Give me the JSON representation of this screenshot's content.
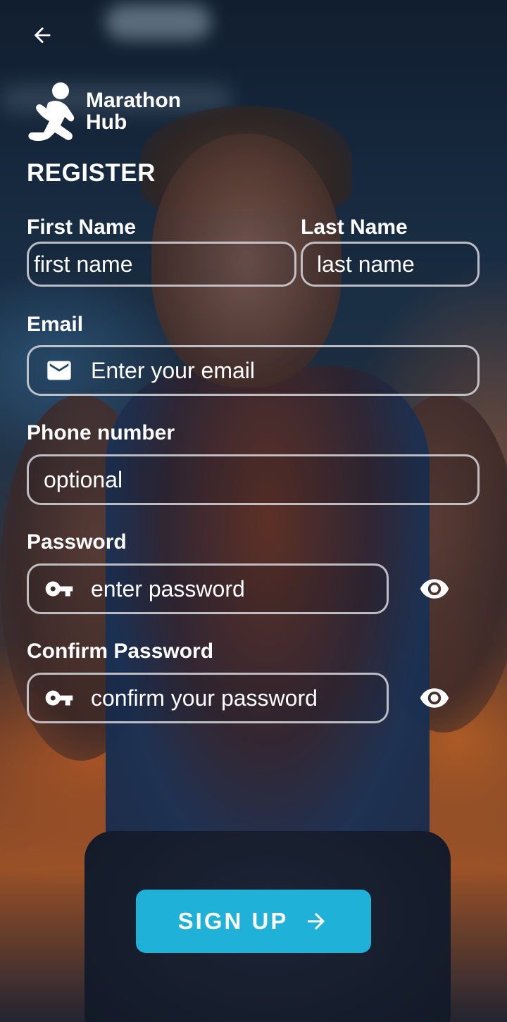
{
  "header": {
    "back_icon": "arrow-left-icon",
    "logo_icon": "runner-icon",
    "logo_line1": "Marathon",
    "logo_line2": "Hub"
  },
  "form": {
    "title": "REGISTER",
    "first_name": {
      "label": "First Name",
      "placeholder": "first name"
    },
    "last_name": {
      "label": "Last Name",
      "placeholder": "last name"
    },
    "email": {
      "label": "Email",
      "placeholder": "Enter your email",
      "icon": "mail-icon"
    },
    "phone": {
      "label": "Phone number",
      "placeholder": "optional"
    },
    "password": {
      "label": "Password",
      "placeholder": "enter password",
      "icon": "key-icon",
      "toggle_icon": "eye-icon"
    },
    "confirm_password": {
      "label": "Confirm Password",
      "placeholder": "confirm your password",
      "icon": "key-icon",
      "toggle_icon": "eye-icon"
    },
    "submit": {
      "label": "SIGN UP",
      "icon": "arrow-right-icon"
    }
  },
  "colors": {
    "accent": "#1fb1d7",
    "field_border": "#d7d7dc",
    "text": "#ffffff"
  }
}
